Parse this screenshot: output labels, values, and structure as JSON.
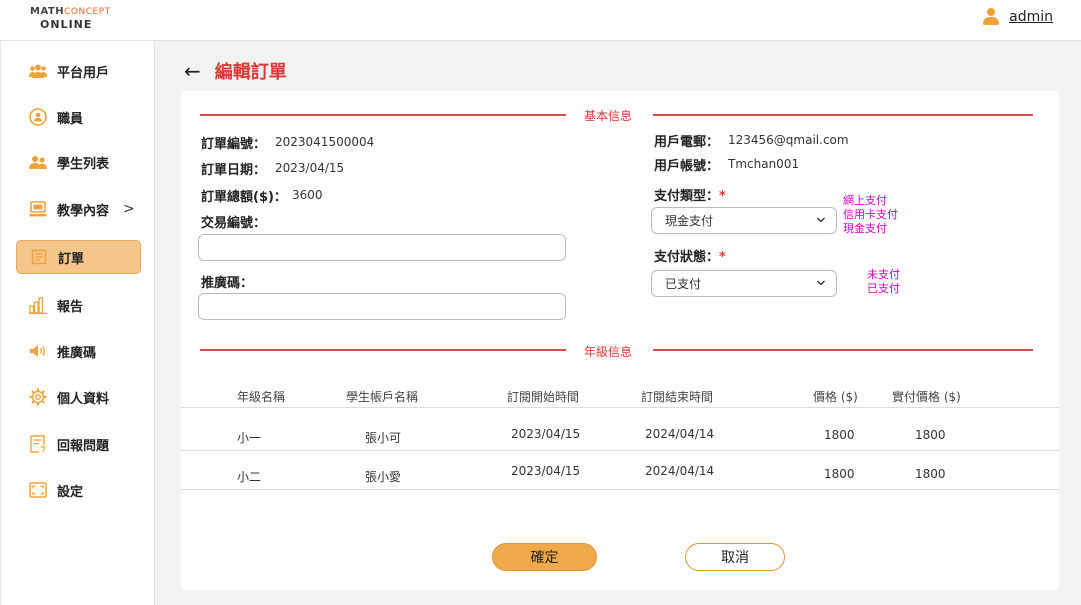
{
  "header": {
    "logo_line1_a": "MATH",
    "logo_line1_b": "CONCEPT",
    "logo_line2": "ONLINE",
    "user_name": "admin"
  },
  "sidebar": {
    "items": [
      {
        "label": "平台用戶",
        "icon": "users-group-icon"
      },
      {
        "label": "職員",
        "icon": "staff-icon"
      },
      {
        "label": "學生列表",
        "icon": "students-icon"
      },
      {
        "label": "教學內容",
        "icon": "monitor-icon",
        "chevron": ">"
      },
      {
        "label": "訂單",
        "icon": "order-icon",
        "active": true
      },
      {
        "label": "報告",
        "icon": "bar-chart-icon"
      },
      {
        "label": "推廣碼",
        "icon": "speaker-icon"
      },
      {
        "label": "個人資料",
        "icon": "gear-icon"
      },
      {
        "label": "回報問題",
        "icon": "report-issue-icon"
      },
      {
        "label": "設定",
        "icon": "settings-frame-icon"
      }
    ]
  },
  "page": {
    "back": "←",
    "title": "編輯訂單"
  },
  "basic": {
    "section_label": "基本信息",
    "order_no_label": "訂單編號：",
    "order_no": "2023041500004",
    "order_date_label": "訂單日期：",
    "order_date": "2023/04/15",
    "order_total_label": "訂單總額($)：",
    "order_total": "3600",
    "txn_label": "交易編號：",
    "txn_value": "",
    "promo_label": "推廣碼：",
    "promo_value": "",
    "email_label": "用戶電郵：",
    "email": "123456@qmail.com",
    "account_label": "用戶帳號：",
    "account": "Tmchan001",
    "pay_type_label": "支付類型：",
    "pay_type_value": "現金支付",
    "pay_type_options": [
      "網上支付",
      "信用卡支付",
      "現金支付"
    ],
    "pay_status_label": "支付狀態：",
    "pay_status_value": "已支付",
    "pay_status_options": [
      "未支付",
      "已支付"
    ],
    "required_mark": "*"
  },
  "grade": {
    "section_label": "年級信息",
    "columns": [
      "年級名稱",
      "學生帳戶名稱",
      "訂閱開始時間",
      "訂閱結束時間",
      "價格 ($)",
      "實付價格 ($)"
    ],
    "rows": [
      [
        "小一",
        "張小可",
        "2023/04/15",
        "2024/04/14",
        "1800",
        "1800"
      ],
      [
        "小二",
        "張小愛",
        "2023/04/15",
        "2024/04/14",
        "1800",
        "1800"
      ]
    ]
  },
  "actions": {
    "confirm": "確定",
    "cancel": "取消"
  },
  "colors": {
    "accent": "#f0a23a",
    "title_red": "#d93a3a",
    "note_magenta": "#d000c8"
  }
}
